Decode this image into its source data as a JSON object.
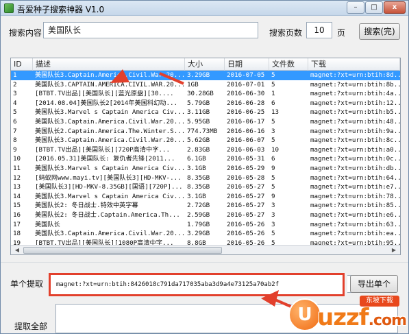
{
  "window": {
    "title": "吾爱种子搜索神器 V1.0",
    "controls": {
      "minimize": "–",
      "maximize": "□",
      "close": "x"
    }
  },
  "search": {
    "label": "搜索内容",
    "value": "美国队长",
    "pages_label": "搜索页数",
    "pages_value": "10",
    "pages_unit": "页",
    "button": "搜索(完)"
  },
  "table": {
    "columns": [
      "ID",
      "描述",
      "大小",
      "日期",
      "文件数",
      "下载"
    ],
    "selected_row": 0,
    "rows": [
      [
        "1",
        "美国队长3.Captain.America.Civil.War.20...",
        "3.29GB",
        "2016-07-05",
        "5",
        "magnet:?xt=urn:btih:8d..."
      ],
      [
        "2",
        "美国队长3.CAPTAIN.AMERICA.CIVIL.WAR.20...",
        "1GB",
        "2016-07-01",
        "5",
        "magnet:?xt=urn:btih:8b..."
      ],
      [
        "3",
        "[BTBT.TV出品][美国队长][蓝光原盘][30....",
        "30.28GB",
        "2016-06-30",
        "1",
        "magnet:?xt=urn:btih:4a..."
      ],
      [
        "4",
        "[2014.08.04]美国队长2[2014年美国科幻动...",
        "5.79GB",
        "2016-06-28",
        "6",
        "magnet:?xt=urn:btih:12..."
      ],
      [
        "5",
        "美国队长3.Marvel s Captain America Civ...",
        "3.11GB",
        "2016-06-25",
        "13",
        "magnet:?xt=urn:btih:b5..."
      ],
      [
        "6",
        "美国队长3.Captain.America.Civil.War.20...",
        "5.95GB",
        "2016-06-17",
        "5",
        "magnet:?xt=urn:btih:48..."
      ],
      [
        "7",
        "美国队长2.Captain.America.The.Winter.S...",
        "774.73MB",
        "2016-06-16",
        "3",
        "magnet:?xt=urn:btih:9a..."
      ],
      [
        "8",
        "美国队长3.Captain.America.Civil.War.20...",
        "5.62GB",
        "2016-06-07",
        "5",
        "magnet:?xt=urn:btih:8c..."
      ],
      [
        "9",
        "[BTBT.TV出品][美国队长][720P高清中字...",
        "2.83GB",
        "2016-06-03",
        "10",
        "magnet:?xt=urn:btih:a0..."
      ],
      [
        "10",
        "[2016.05.31]美国队长: 复仇者先锋[2011...",
        "6.1GB",
        "2016-05-31",
        "6",
        "magnet:?xt=urn:btih:0c..."
      ],
      [
        "11",
        "美国队长3.Marvel s Captain America Civ...",
        "3.1GB",
        "2016-05-29",
        "9",
        "magnet:?xt=urn:btih:db..."
      ],
      [
        "12",
        "[蚂蚁网www.mayi.tv][美国队长3][HD-MKV-...",
        "8.35GB",
        "2016-05-28",
        "5",
        "magnet:?xt=urn:btih:64..."
      ],
      [
        "13",
        "[美国队长3][HD-MKV-8.35GB][国语][720P]...",
        "8.35GB",
        "2016-05-27",
        "5",
        "magnet:?xt=urn:btih:e7..."
      ],
      [
        "14",
        "美国队长3.Marvel s Captain America Civ...",
        "3.1GB",
        "2016-05-27",
        "9",
        "magnet:?xt=urn:btih:78..."
      ],
      [
        "15",
        "美国队长2: 冬日战士.特效中英字幕",
        "2.72GB",
        "2016-05-27",
        "3",
        "magnet:?xt=urn:btih:85..."
      ],
      [
        "16",
        "美国队长2: 冬日战士.Captain.America.Th...",
        "2.59GB",
        "2016-05-27",
        "3",
        "magnet:?xt=urn:btih:e6..."
      ],
      [
        "17",
        "美国队长",
        "1.79GB",
        "2016-05-26",
        "3",
        "magnet:?xt=urn:btih:63..."
      ],
      [
        "18",
        "美国队长3.Captain.America.Civil.War.20...",
        "3.29GB",
        "2016-05-26",
        "5",
        "magnet:?xt=urn:btih:ea..."
      ],
      [
        "19",
        "[BTBT.TV出品][美国队长][1080P高清中字...",
        "8.8GB",
        "2016-05-26",
        "5",
        "magnet:?xt=urn:btih:95..."
      ]
    ]
  },
  "single": {
    "label": "单个提取",
    "value": "magnet:?xt=urn:btih:8426018c791da717035aba3d9a4e73125a70ab2f",
    "button": "导出单个"
  },
  "bulk": {
    "label": "提取全部"
  },
  "watermark": {
    "brand": "uzzf",
    "suffix": ".com",
    "badge": "东坡下载"
  },
  "colors": {
    "selection": "#3399ff",
    "annotation_red": "#e2402c",
    "watermark_orange": "#f07a18"
  }
}
